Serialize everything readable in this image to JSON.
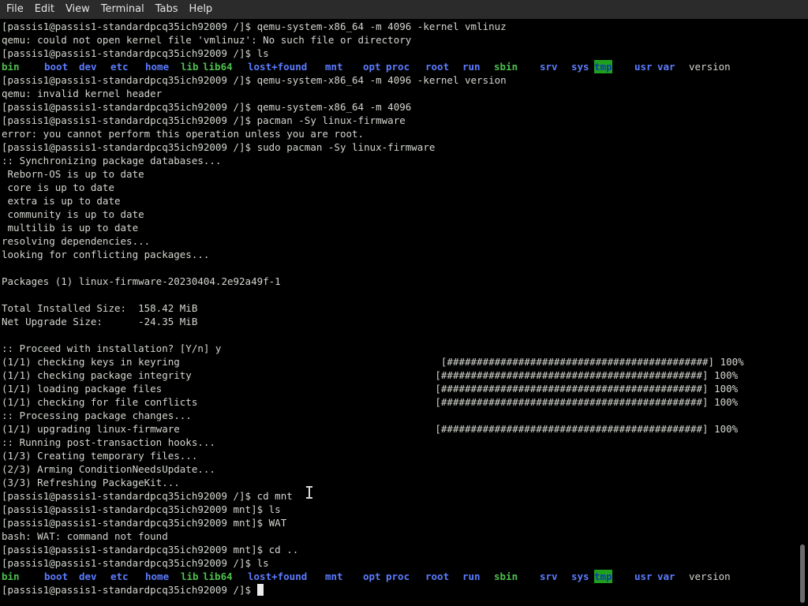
{
  "menu": [
    {
      "id": "file",
      "label": "File"
    },
    {
      "id": "edit",
      "label": "Edit"
    },
    {
      "id": "view",
      "label": "View"
    },
    {
      "id": "terminal",
      "label": "Terminal"
    },
    {
      "id": "tabs",
      "label": "Tabs"
    },
    {
      "id": "help",
      "label": "Help"
    }
  ],
  "terminal": {
    "lines": [
      {
        "kind": "text",
        "text": "[passis1@passis1-standardpcq35ich92009 /]$ qemu-system-x86_64 -m 4096 -kernel vmlinuz"
      },
      {
        "kind": "text",
        "text": "qemu: could not open kernel file 'vmlinuz': No such file or directory"
      },
      {
        "kind": "text",
        "text": "[passis1@passis1-standardpcq35ich92009 /]$ ls"
      },
      {
        "kind": "ls"
      },
      {
        "kind": "text",
        "text": "[passis1@passis1-standardpcq35ich92009 /]$ qemu-system-x86_64 -m 4096 -kernel version"
      },
      {
        "kind": "text",
        "text": "qemu: invalid kernel header"
      },
      {
        "kind": "text",
        "text": "[passis1@passis1-standardpcq35ich92009 /]$ qemu-system-x86_64 -m 4096"
      },
      {
        "kind": "text",
        "text": "[passis1@passis1-standardpcq35ich92009 /]$ pacman -Sy linux-firmware"
      },
      {
        "kind": "text",
        "text": "error: you cannot perform this operation unless you are root."
      },
      {
        "kind": "text",
        "text": "[passis1@passis1-standardpcq35ich92009 /]$ sudo pacman -Sy linux-firmware"
      },
      {
        "kind": "text",
        "text": ":: Synchronizing package databases..."
      },
      {
        "kind": "text",
        "text": " Reborn-OS is up to date"
      },
      {
        "kind": "text",
        "text": " core is up to date"
      },
      {
        "kind": "text",
        "text": " extra is up to date"
      },
      {
        "kind": "text",
        "text": " community is up to date"
      },
      {
        "kind": "text",
        "text": " multilib is up to date"
      },
      {
        "kind": "text",
        "text": "resolving dependencies..."
      },
      {
        "kind": "text",
        "text": "looking for conflicting packages..."
      },
      {
        "kind": "text",
        "text": ""
      },
      {
        "kind": "text",
        "text": "Packages (1) linux-firmware-20230404.2e92a49f-1"
      },
      {
        "kind": "text",
        "text": ""
      },
      {
        "kind": "text",
        "text": "Total Installed Size:  158.42 MiB"
      },
      {
        "kind": "text",
        "text": "Net Upgrade Size:      -24.35 MiB"
      },
      {
        "kind": "text",
        "text": ""
      },
      {
        "kind": "text",
        "text": ":: Proceed with installation? [Y/n] y"
      },
      {
        "kind": "text",
        "text": "(1/1) checking keys in keyring                                            [############################################] 100%"
      },
      {
        "kind": "text",
        "text": "(1/1) checking package integrity                                         [############################################] 100%"
      },
      {
        "kind": "text",
        "text": "(1/1) loading package files                                              [############################################] 100%"
      },
      {
        "kind": "text",
        "text": "(1/1) checking for file conflicts                                        [############################################] 100%"
      },
      {
        "kind": "text",
        "text": ":: Processing package changes..."
      },
      {
        "kind": "text",
        "text": "(1/1) upgrading linux-firmware                                           [############################################] 100%"
      },
      {
        "kind": "text",
        "text": ":: Running post-transaction hooks..."
      },
      {
        "kind": "text",
        "text": "(1/3) Creating temporary files..."
      },
      {
        "kind": "text",
        "text": "(2/3) Arming ConditionNeedsUpdate..."
      },
      {
        "kind": "text",
        "text": "(3/3) Refreshing PackageKit..."
      },
      {
        "kind": "text",
        "text": "[passis1@passis1-standardpcq35ich92009 /]$ cd mnt"
      },
      {
        "kind": "text",
        "text": "[passis1@passis1-standardpcq35ich92009 mnt]$ ls"
      },
      {
        "kind": "text",
        "text": "[passis1@passis1-standardpcq35ich92009 mnt]$ WAT"
      },
      {
        "kind": "text",
        "text": "bash: WAT: command not found"
      },
      {
        "kind": "text",
        "text": "[passis1@passis1-standardpcq35ich92009 mnt]$ cd .."
      },
      {
        "kind": "text",
        "text": "[passis1@passis1-standardpcq35ich92009 /]$ ls"
      },
      {
        "kind": "ls"
      },
      {
        "kind": "prompt",
        "text": "[passis1@passis1-standardpcq35ich92009 /]$ "
      }
    ],
    "ls_entries": [
      {
        "name": "bin",
        "type": "exe"
      },
      {
        "name": "boot",
        "type": "dir"
      },
      {
        "name": "dev",
        "type": "dir"
      },
      {
        "name": "etc",
        "type": "dir"
      },
      {
        "name": "home",
        "type": "dir"
      },
      {
        "name": "lib",
        "type": "exe"
      },
      {
        "name": "lib64",
        "type": "exe"
      },
      {
        "name": "lost+found",
        "type": "dir"
      },
      {
        "name": "mnt",
        "type": "dir"
      },
      {
        "name": "opt",
        "type": "dir"
      },
      {
        "name": "proc",
        "type": "dir"
      },
      {
        "name": "root",
        "type": "dir"
      },
      {
        "name": "run",
        "type": "dir"
      },
      {
        "name": "sbin",
        "type": "exe"
      },
      {
        "name": "srv",
        "type": "dir"
      },
      {
        "name": "sys",
        "type": "dir"
      },
      {
        "name": "tmp",
        "type": "sticky"
      },
      {
        "name": "usr",
        "type": "dir"
      },
      {
        "name": "var",
        "type": "dir"
      },
      {
        "name": "version",
        "type": "file"
      }
    ]
  },
  "scrollbar": {
    "thumb_fraction": 0.1,
    "position_fraction": 1.0
  },
  "colors": {
    "background": "#000000",
    "foreground": "#d3d7cf",
    "directory": "#5c7cff",
    "executable": "#4ec04e",
    "sticky_bg": "#1fa01f",
    "menubar_bg": "#2b2b2b"
  }
}
